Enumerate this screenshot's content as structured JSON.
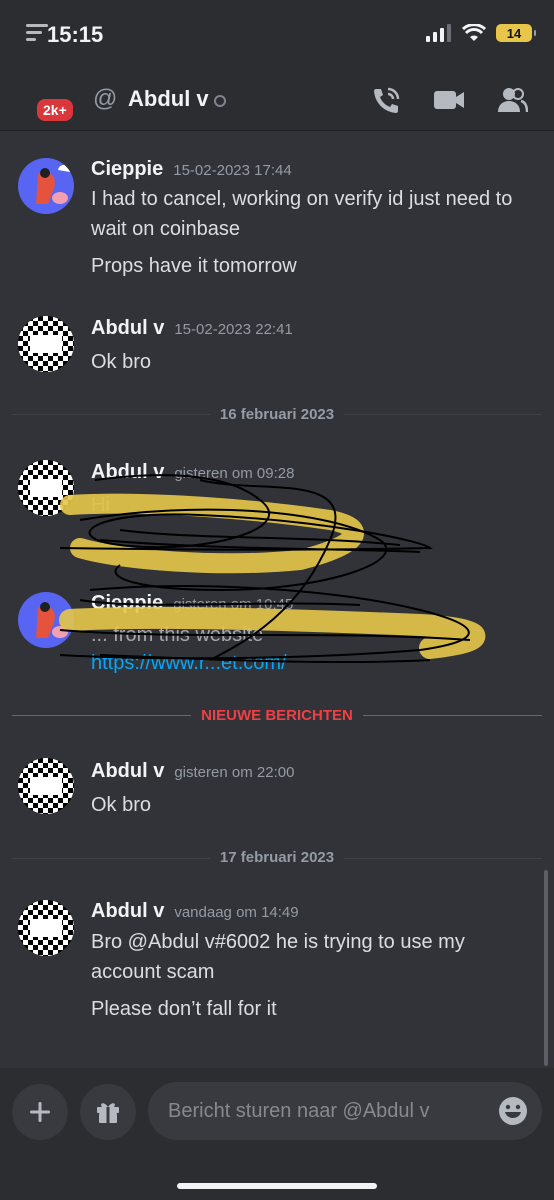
{
  "status": {
    "time": "15:15",
    "battery": "14"
  },
  "header": {
    "badge": "2k+",
    "title": "Abdul v"
  },
  "messages": [
    {
      "author": "Cieppie",
      "time": "15-02-2023 17:44",
      "lines": [
        "I had to cancel, working on verify id just need to wait on coinbase",
        "Props have it tomorrow"
      ]
    },
    {
      "author": "Abdul v",
      "time": "15-02-2023 22:41",
      "lines": [
        "Ok bro"
      ]
    },
    {
      "author": "Abdul v",
      "time": "gisteren om 09:28",
      "lines": [
        "Hi",
        ""
      ]
    },
    {
      "author": "Cieppie",
      "time": "gisteren om 10:45",
      "lines": [
        "... from this website",
        "https://www.r...et.com/"
      ]
    },
    {
      "author": "Abdul v",
      "time": "gisteren om 22:00",
      "lines": [
        "Ok bro"
      ]
    },
    {
      "author": "Abdul v",
      "time": "vandaag om 14:49",
      "lines": [
        "Bro @Abdul v#6002 he is trying to use my account scam",
        "Please don’t fall for it"
      ]
    }
  ],
  "dividers": {
    "day1": "16 februari 2023",
    "new": "NIEUWE BERICHTEN",
    "day2": "17 februari 2023"
  },
  "composer": {
    "placeholder": "Bericht sturen naar @Abdul v"
  },
  "colors": {
    "background": "#313338",
    "accent_red": "#da373c",
    "link": "#00a8fc",
    "scribble_yellow": "#e7c64a"
  }
}
